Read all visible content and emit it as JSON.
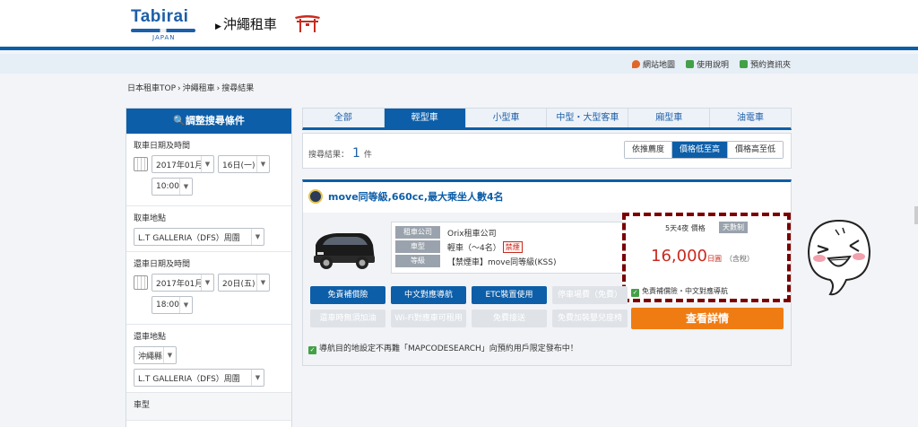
{
  "header": {
    "logo_brand": "Tabirai",
    "logo_sub": "JAPAN",
    "site_title": "沖繩租車"
  },
  "subbar": {
    "links": [
      "網站地圖",
      "使用說明",
      "預約資訊夾"
    ],
    "link_icon_colors": [
      "#e0672a",
      "#43a047",
      "#43a047"
    ]
  },
  "breadcrumb": [
    "日本租車TOP",
    "沖繩租車",
    "搜尋結果"
  ],
  "sidebar": {
    "title": "調整搜尋條件",
    "pickup_datetime_label": "取車日期及時間",
    "pickup_month": "2017年01月",
    "pickup_day": "16日(一)",
    "pickup_time": "10:00",
    "pickup_place_label": "取車地點",
    "pickup_place": "L.T GALLERIA（DFS）周圍",
    "return_datetime_label": "還車日期及時間",
    "return_month": "2017年01月",
    "return_day": "20日(五)",
    "return_time": "18:00",
    "return_place_label": "還車地點",
    "return_pref": "沖繩縣",
    "return_place": "L.T GALLERIA（DFS）周圍",
    "car_type_label": "車型"
  },
  "tabs": [
    {
      "label": "全部",
      "active": false
    },
    {
      "label": "輕型車",
      "active": true
    },
    {
      "label": "小型車",
      "active": false
    },
    {
      "label": "中型・大型客車",
      "active": false
    },
    {
      "label": "廂型車",
      "active": false
    },
    {
      "label": "油電車",
      "active": false
    }
  ],
  "results": {
    "label": "搜尋結果：",
    "count": "1",
    "unit": "件",
    "sort": [
      {
        "label": "依推薦度",
        "active": false
      },
      {
        "label": "價格低至高",
        "active": true
      },
      {
        "label": "價格高至低",
        "active": false
      }
    ]
  },
  "card": {
    "title": "move同等級,660cc,最大乘坐人數4名",
    "spec": {
      "company_key": "租車公司",
      "company": "Orix租車公司",
      "type_key": "車型",
      "type": "輕車（～4名）",
      "smoke_badge": "禁煙",
      "class_key": "等級",
      "class": "【禁煙車】move同等級(KSS)"
    },
    "price": {
      "days": "5天4夜 價格",
      "tag": "天數制",
      "amount": "16,000",
      "unit": "日圓",
      "tax": "（含稅）",
      "included_note": "免責補償險・中文對應導航"
    },
    "options": [
      {
        "label": "免責補償險",
        "on": true
      },
      {
        "label": "中文對應導航",
        "on": true
      },
      {
        "label": "ETC裝置使用",
        "on": true
      },
      {
        "label": "停車場費（免費）",
        "on": false
      },
      {
        "label": "還車時無須加油",
        "on": false
      },
      {
        "label": "Wi-Fi對應車可租用",
        "on": false
      },
      {
        "label": "免費接送",
        "on": false
      },
      {
        "label": "免費加裝嬰兒座椅",
        "on": false
      }
    ],
    "detail_button": "查看詳情",
    "note": "導航目的地設定不再難「MAPCODESEARCH」向預約用戶限定發布中！"
  },
  "colors": {
    "primary": "#0d5ea8",
    "price": "#c92a1e",
    "cta": "#ef7c13",
    "highlight_border": "#7a0000"
  }
}
